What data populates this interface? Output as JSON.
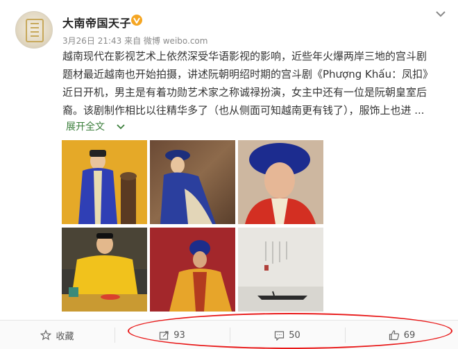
{
  "post": {
    "username": "大南帝国天子",
    "meta": "3月26日 21:43 来自 微博 weibo.com",
    "content_lines": [
      "越南现代在影视艺术上依然深受华语影视的影响，近些年火爆两岸三地的宫斗剧",
      "题材最近越南也开始拍摄，讲述阮朝明绍时期的宫斗剧《Phượng Khấu：凤扣》",
      "近日开机，男主是有着功勋艺术家之称诚禄扮演，女主中还有一位是阮朝皇室后",
      "裔。该剧制作相比以往精华多了（也从侧面可知越南更有钱了），服饰上也进 ..."
    ],
    "expand_label": "展开全文"
  },
  "photos": [
    {
      "name": "photo-emperor-blue-robe"
    },
    {
      "name": "photo-woman-seated-blue-robe"
    },
    {
      "name": "photo-woman-blue-headdress"
    },
    {
      "name": "photo-emperor-yellow-robe-desk"
    },
    {
      "name": "photo-woman-yellow-robe-red-bg"
    },
    {
      "name": "photo-boat-on-water"
    }
  ],
  "actions": {
    "favorite_label": "收藏",
    "repost_count": "93",
    "comment_count": "50",
    "like_count": "69"
  },
  "colors": {
    "expand_green": "#3a7e3a",
    "verified_orange": "#f5a623",
    "annotation_red": "#e81818"
  }
}
